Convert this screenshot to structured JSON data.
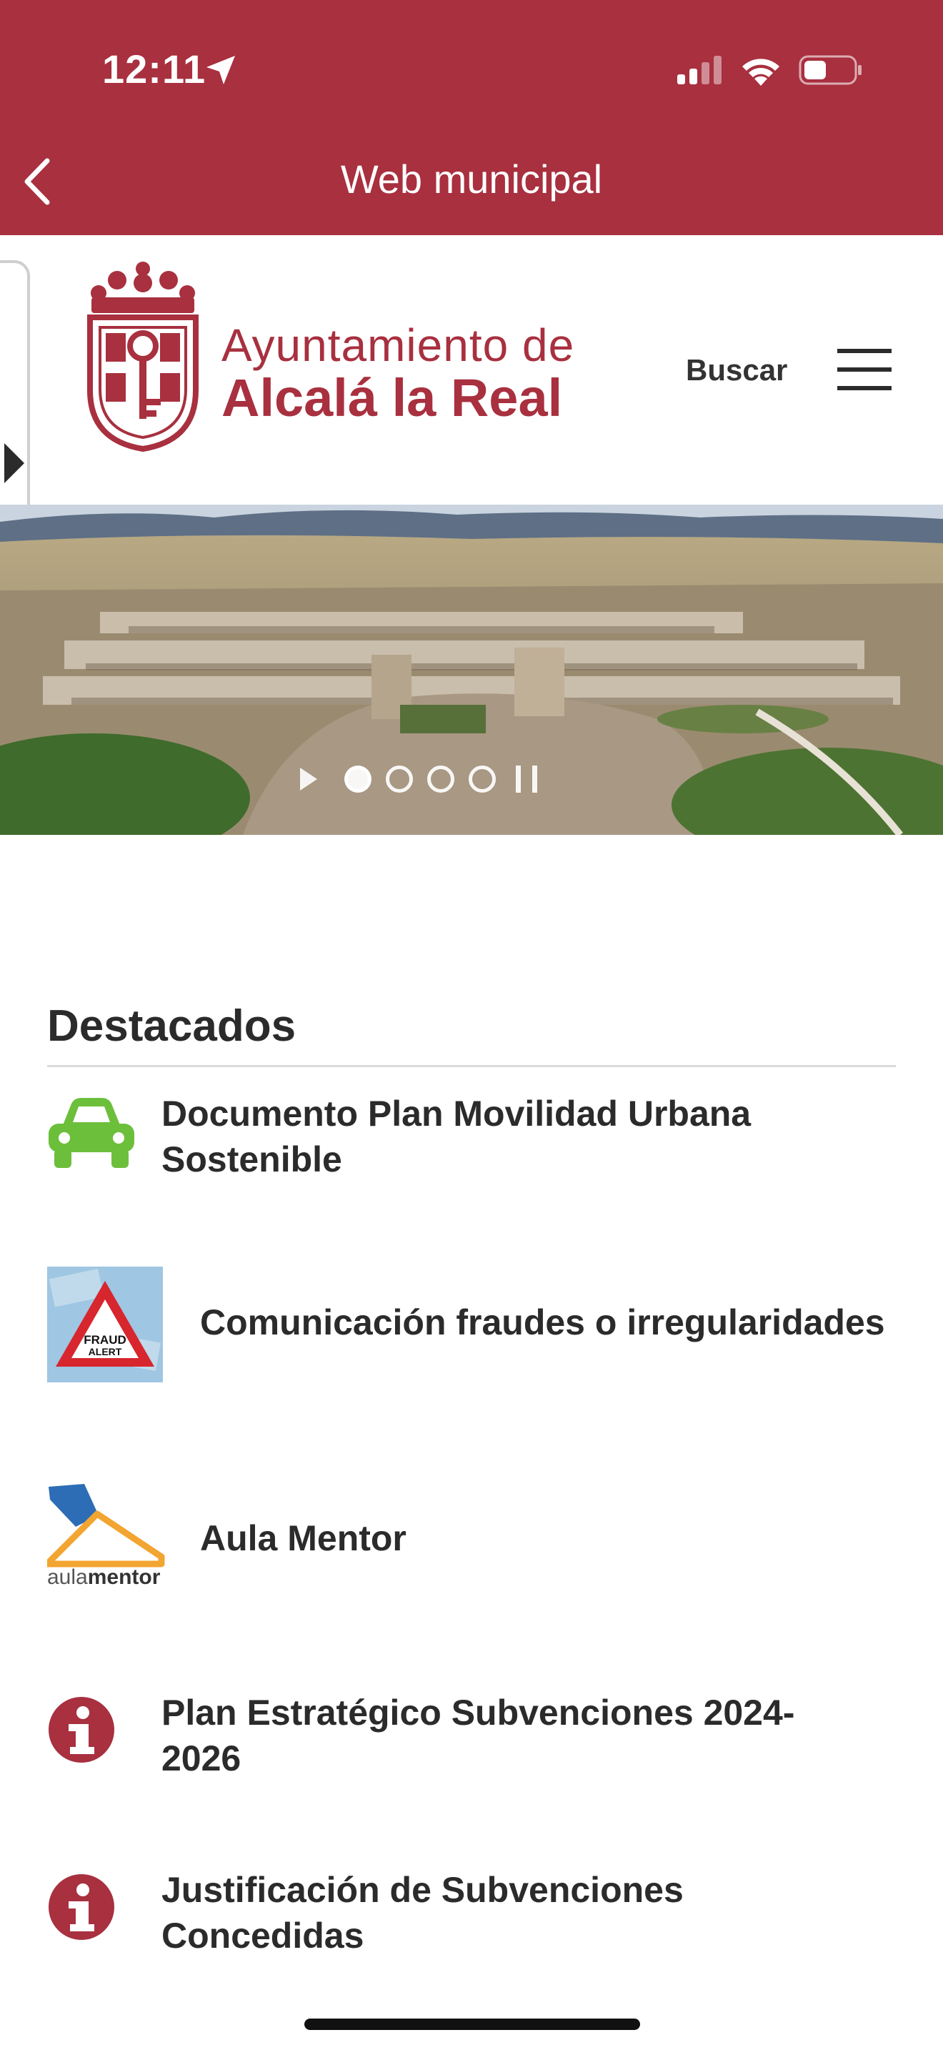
{
  "status_bar": {
    "time": "12:11"
  },
  "nav": {
    "title": "Web municipal"
  },
  "header": {
    "org_line1": "Ayuntamiento de",
    "org_line2": "Alcalá la Real",
    "search_label": "Buscar"
  },
  "hero": {
    "slide_count": 4,
    "active_slide": 1
  },
  "destacados": {
    "title": "Destacados",
    "items": [
      {
        "label_line1": "Documento Plan Movilidad Urbana",
        "label_line2": "Sostenible",
        "icon": "car-icon"
      },
      {
        "label_line1": "Comunicación fraudes o irregularidades",
        "icon": "fraud-alert-icon",
        "icon_text_1": "FRAUD",
        "icon_text_2": "ALERT"
      },
      {
        "label_line1": "Aula Mentor",
        "icon": "aula-mentor-logo",
        "icon_text_1": "aula",
        "icon_text_2": "mentor"
      },
      {
        "label_line1": "Plan Estratégico Subvenciones 2024-",
        "label_line2": "2026",
        "icon": "info-icon"
      },
      {
        "label_line1": "Justificación de Subvenciones",
        "label_line2": "Concedidas",
        "icon": "info-icon"
      }
    ]
  },
  "colors": {
    "brand": "#a8303f",
    "car_green": "#6cbf3a",
    "text": "#2b2b2b"
  }
}
